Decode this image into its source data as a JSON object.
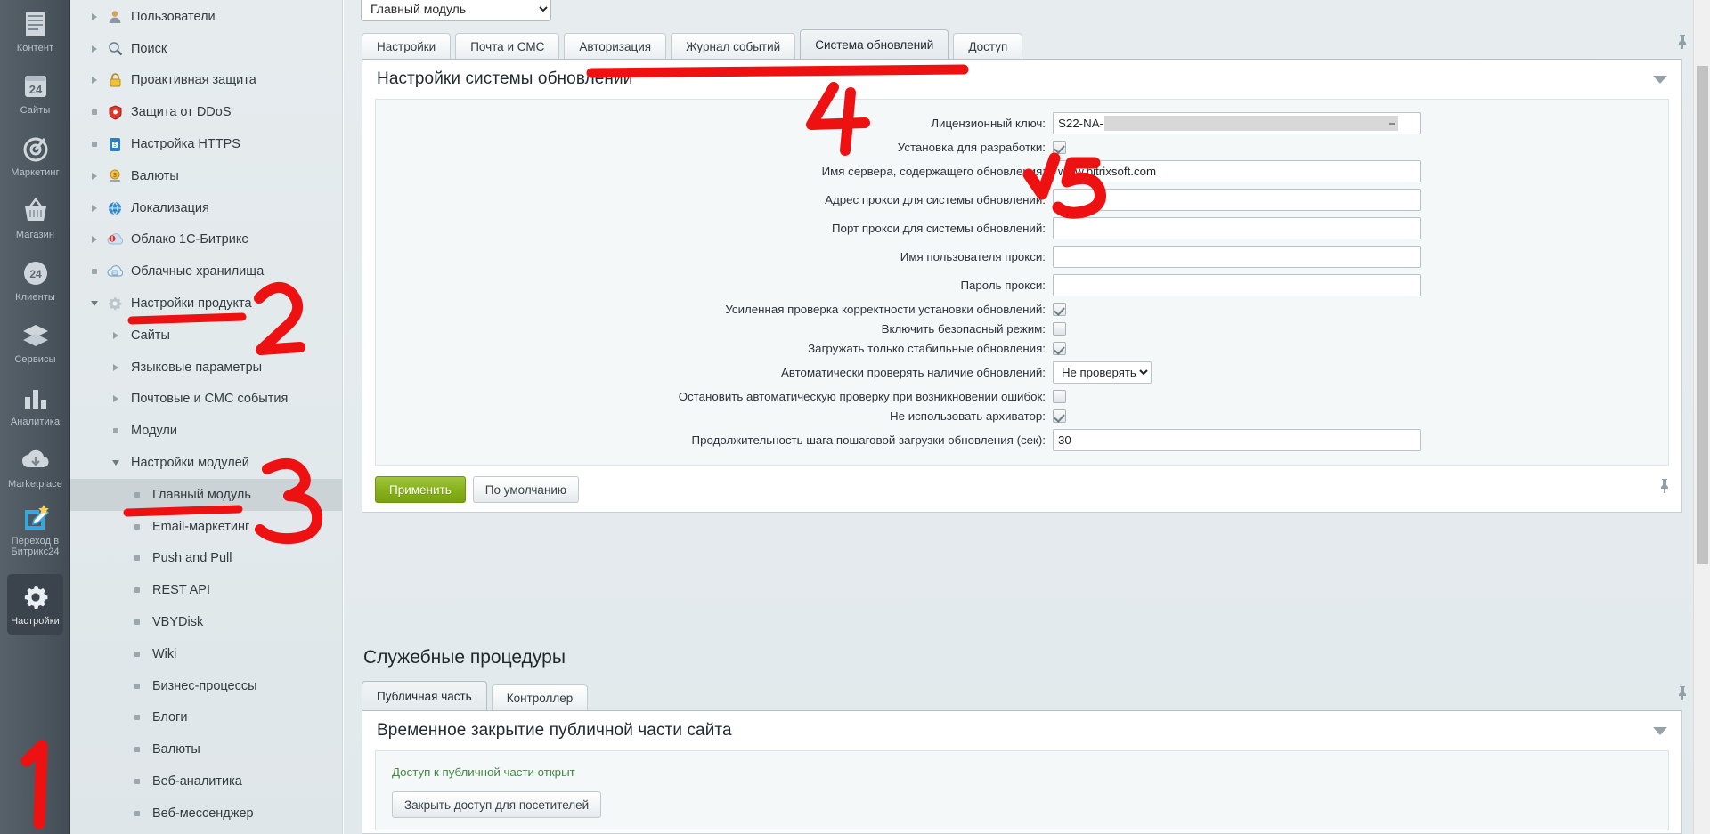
{
  "rail": {
    "items": [
      {
        "label": "Контент",
        "icon": "content-icon",
        "active": false
      },
      {
        "label": "Сайты",
        "icon": "sites-24-icon",
        "active": false
      },
      {
        "label": "Маркетинг",
        "icon": "marketing-target-icon",
        "active": false
      },
      {
        "label": "Магазин",
        "icon": "shop-basket-icon",
        "active": false
      },
      {
        "label": "Клиенты",
        "icon": "clients-24-icon",
        "active": false
      },
      {
        "label": "Сервисы",
        "icon": "services-layers-icon",
        "active": false
      },
      {
        "label": "Аналитика",
        "icon": "analytics-bars-icon",
        "active": false
      },
      {
        "label": "Marketplace",
        "icon": "marketplace-cloud-icon",
        "active": false
      },
      {
        "label": "Переход в Битрикс24",
        "icon": "bitrix24-pencil-icon",
        "active": false
      },
      {
        "label": "Настройки",
        "icon": "settings-gear-icon",
        "active": true
      }
    ]
  },
  "tree": {
    "items": [
      {
        "label": "Пользователи",
        "marker": "arrow-right",
        "icon": "user-icon",
        "indent": 1,
        "selected": false
      },
      {
        "label": "Поиск",
        "marker": "arrow-right",
        "icon": "search-icon",
        "indent": 1,
        "selected": false
      },
      {
        "label": "Проактивная защита",
        "marker": "arrow-right",
        "icon": "lock-icon",
        "indent": 1,
        "selected": false
      },
      {
        "label": "Защита от DDoS",
        "marker": "dot",
        "icon": "shield-icon",
        "indent": 1,
        "selected": false
      },
      {
        "label": "Настройка HTTPS",
        "marker": "dot",
        "icon": "https-lock-icon",
        "indent": 1,
        "selected": false
      },
      {
        "label": "Валюты",
        "marker": "arrow-right",
        "icon": "currency-icon",
        "indent": 1,
        "selected": false
      },
      {
        "label": "Локализация",
        "marker": "arrow-right",
        "icon": "globe-icon",
        "indent": 1,
        "selected": false
      },
      {
        "label": "Облако 1С-Битрикс",
        "marker": "arrow-right",
        "icon": "cloud-bitrix-icon",
        "indent": 1,
        "selected": false
      },
      {
        "label": "Облачные хранилища",
        "marker": "dot",
        "icon": "cloud-storage-icon",
        "indent": 1,
        "selected": false
      },
      {
        "label": "Настройки продукта",
        "marker": "arrow-down",
        "icon": "gear-icon",
        "indent": 1,
        "selected": false
      },
      {
        "label": "Сайты",
        "marker": "arrow-right",
        "icon": "none",
        "indent": 2,
        "selected": false
      },
      {
        "label": "Языковые параметры",
        "marker": "arrow-right",
        "icon": "none",
        "indent": 2,
        "selected": false
      },
      {
        "label": "Почтовые и СМС события",
        "marker": "arrow-right",
        "icon": "none",
        "indent": 2,
        "selected": false
      },
      {
        "label": "Модули",
        "marker": "dot",
        "icon": "none",
        "indent": 2,
        "selected": false
      },
      {
        "label": "Настройки модулей",
        "marker": "arrow-down",
        "icon": "none",
        "indent": 2,
        "selected": false
      },
      {
        "label": "Главный модуль",
        "marker": "dot",
        "icon": "none",
        "indent": 3,
        "selected": true
      },
      {
        "label": "Email-маркетинг",
        "marker": "dot",
        "icon": "none",
        "indent": 3,
        "selected": false
      },
      {
        "label": "Push and Pull",
        "marker": "dot",
        "icon": "none",
        "indent": 3,
        "selected": false
      },
      {
        "label": "REST API",
        "marker": "dot",
        "icon": "none",
        "indent": 3,
        "selected": false
      },
      {
        "label": "VBYDisk",
        "marker": "dot",
        "icon": "none",
        "indent": 3,
        "selected": false
      },
      {
        "label": "Wiki",
        "marker": "dot",
        "icon": "none",
        "indent": 3,
        "selected": false
      },
      {
        "label": "Бизнес-процессы",
        "marker": "dot",
        "icon": "none",
        "indent": 3,
        "selected": false
      },
      {
        "label": "Блоги",
        "marker": "dot",
        "icon": "none",
        "indent": 3,
        "selected": false
      },
      {
        "label": "Валюты",
        "marker": "dot",
        "icon": "none",
        "indent": 3,
        "selected": false
      },
      {
        "label": "Веб-аналитика",
        "marker": "dot",
        "icon": "none",
        "indent": 3,
        "selected": false
      },
      {
        "label": "Веб-мессенджер",
        "marker": "dot",
        "icon": "none",
        "indent": 3,
        "selected": false
      }
    ]
  },
  "module_select": {
    "value": "Главный модуль",
    "options": [
      "Главный модуль"
    ]
  },
  "tabs": [
    {
      "label": "Настройки",
      "active": false
    },
    {
      "label": "Почта и СМС",
      "active": false
    },
    {
      "label": "Авторизация",
      "active": false
    },
    {
      "label": "Журнал событий",
      "active": false
    },
    {
      "label": "Система обновлений",
      "active": true
    },
    {
      "label": "Доступ",
      "active": false
    }
  ],
  "update_panel": {
    "title": "Настройки системы обновлений",
    "fields": [
      {
        "label": "Лицензионный ключ:",
        "type": "text-masked",
        "value": "S22-NA-"
      },
      {
        "label": "Установка для разработки:",
        "type": "checkbox",
        "checked": true
      },
      {
        "label": "Имя сервера, содержащего обновления:",
        "type": "text",
        "value": "www.bitrixsoft.com"
      },
      {
        "label": "Адрес прокси для системы обновлений:",
        "type": "text",
        "value": ""
      },
      {
        "label": "Порт прокси для системы обновлений:",
        "type": "text",
        "value": ""
      },
      {
        "label": "Имя пользователя прокси:",
        "type": "text",
        "value": ""
      },
      {
        "label": "Пароль прокси:",
        "type": "text",
        "value": ""
      },
      {
        "label": "Усиленная проверка корректности установки обновлений:",
        "type": "checkbox",
        "checked": true
      },
      {
        "label": "Включить безопасный режим:",
        "type": "checkbox",
        "checked": false
      },
      {
        "label": "Загружать только стабильные обновления:",
        "type": "checkbox",
        "checked": true
      },
      {
        "label": "Автоматически проверять наличие обновлений:",
        "type": "select",
        "value": "Не проверять",
        "options": [
          "Не проверять"
        ]
      },
      {
        "label": "Остановить автоматическую проверку при возникновении ошибок:",
        "type": "checkbox",
        "checked": false
      },
      {
        "label": "Не использовать архиватор:",
        "type": "checkbox",
        "checked": true
      },
      {
        "label": "Продолжительность шага пошаговой загрузки обновления (сек):",
        "type": "text",
        "value": "30"
      }
    ],
    "apply_label": "Применить",
    "default_label": "По умолчанию"
  },
  "service_section": {
    "title": "Служебные процедуры",
    "tabs": [
      {
        "label": "Публичная часть",
        "active": true
      },
      {
        "label": "Контроллер",
        "active": false
      }
    ],
    "panel_title": "Временное закрытие публичной части сайта",
    "status_text": "Доступ к публичной части открыт",
    "close_button": "Закрыть доступ для посетителей"
  },
  "annotations": [
    {
      "number": "1",
      "target": "settings-rail-item"
    },
    {
      "number": "2",
      "target": "product-settings-tree-node"
    },
    {
      "number": "3",
      "target": "main-module-tree-node"
    },
    {
      "number": "4",
      "target": "update-system-tab"
    },
    {
      "number": "5",
      "target": "dev-install-checkbox"
    }
  ],
  "colors": {
    "accent_green": "#86b019",
    "rail_bg": "#4f5a64",
    "tree_bg": "#e3eaec",
    "annotation_red": "#ee1111"
  }
}
